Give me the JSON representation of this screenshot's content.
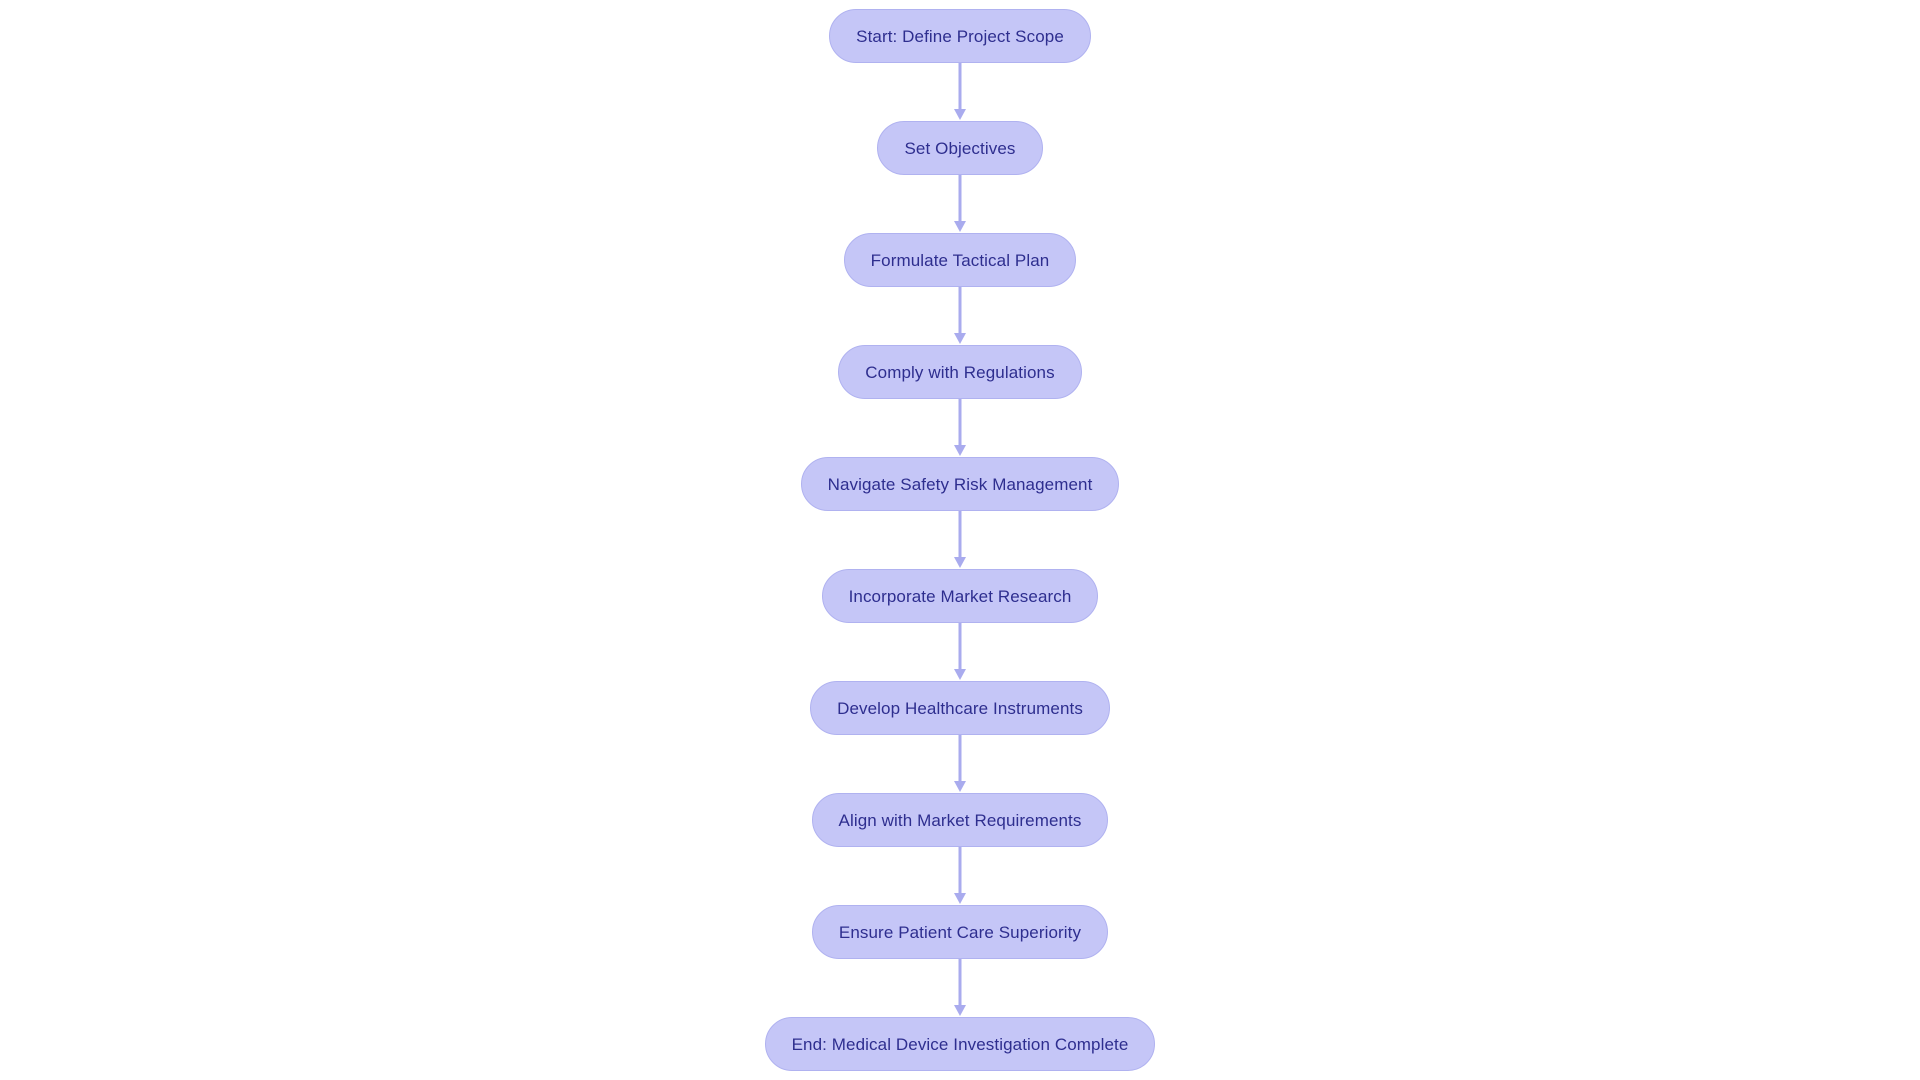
{
  "diagram": {
    "type": "flowchart",
    "orientation": "top-to-bottom",
    "background_color": "#ffffff",
    "node_fill_color": "#c5c6f7",
    "node_border_color": "#b0b2f0",
    "node_text_color": "#2e2e8f",
    "connector_color": "#a9abee",
    "nodes": [
      {
        "id": "n1",
        "label": "Start: Define Project Scope"
      },
      {
        "id": "n2",
        "label": "Set Objectives"
      },
      {
        "id": "n3",
        "label": "Formulate Tactical Plan"
      },
      {
        "id": "n4",
        "label": "Comply with Regulations"
      },
      {
        "id": "n5",
        "label": "Navigate Safety Risk Management"
      },
      {
        "id": "n6",
        "label": "Incorporate Market Research"
      },
      {
        "id": "n7",
        "label": "Develop Healthcare Instruments"
      },
      {
        "id": "n8",
        "label": "Align with Market Requirements"
      },
      {
        "id": "n9",
        "label": "Ensure Patient Care Superiority"
      },
      {
        "id": "n10",
        "label": "End: Medical Device Investigation Complete"
      }
    ],
    "edges": [
      {
        "from": "n1",
        "to": "n2",
        "arrow": "down-arrow-icon"
      },
      {
        "from": "n2",
        "to": "n3",
        "arrow": "down-arrow-icon"
      },
      {
        "from": "n3",
        "to": "n4",
        "arrow": "down-arrow-icon"
      },
      {
        "from": "n4",
        "to": "n5",
        "arrow": "down-arrow-icon"
      },
      {
        "from": "n5",
        "to": "n6",
        "arrow": "down-arrow-icon"
      },
      {
        "from": "n6",
        "to": "n7",
        "arrow": "down-arrow-icon"
      },
      {
        "from": "n7",
        "to": "n8",
        "arrow": "down-arrow-icon"
      },
      {
        "from": "n8",
        "to": "n9",
        "arrow": "down-arrow-icon"
      },
      {
        "from": "n9",
        "to": "n10",
        "arrow": "down-arrow-icon"
      }
    ]
  }
}
